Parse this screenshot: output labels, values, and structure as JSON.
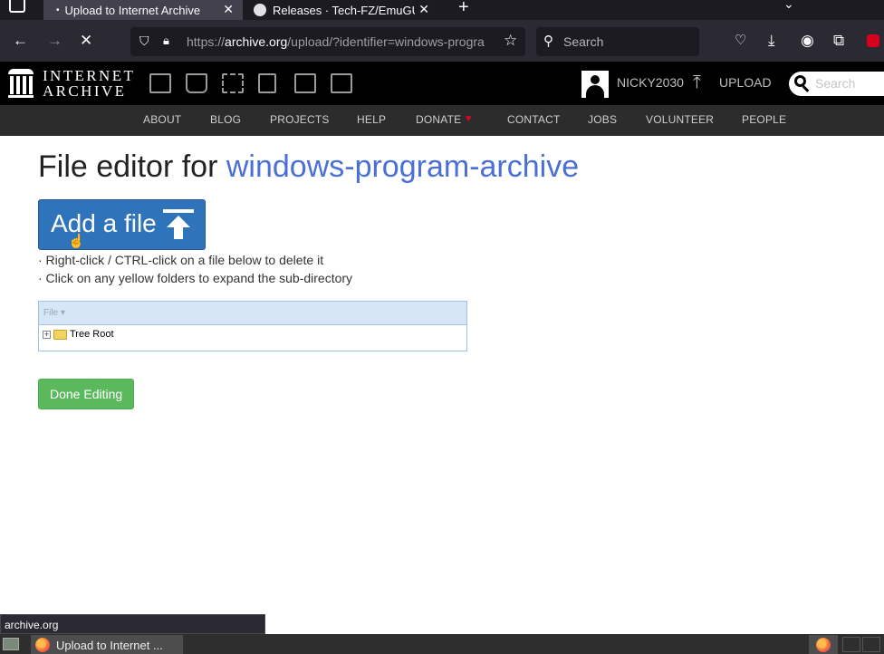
{
  "browser": {
    "tabs": [
      {
        "label": "Upload to Internet Archive",
        "active": true
      },
      {
        "label": "Releases · Tech-FZ/EmuGUI",
        "active": false
      }
    ],
    "url_prefix": "https://",
    "url_host": "archive.org",
    "url_rest": "/upload/?identifier=windows-progra",
    "search_placeholder": "Search"
  },
  "ia_header": {
    "logo_line1": "INTERNET",
    "logo_line2": "ARCHIVE",
    "username": "NICKY2030",
    "upload_label": "UPLOAD",
    "search_placeholder": "Search",
    "nav": [
      "ABOUT",
      "BLOG",
      "PROJECTS",
      "HELP",
      "DONATE",
      "CONTACT",
      "JOBS",
      "VOLUNTEER",
      "PEOPLE"
    ]
  },
  "main": {
    "title_prefix": "File editor for ",
    "identifier": "windows-program-archive",
    "add_file_label": "Add a file",
    "hints": [
      "· Right-click / CTRL-click on a file below to delete it",
      "· Click on any yellow folders to expand the sub-directory"
    ],
    "tree_header": "File ▾",
    "tree_root": "Tree Root",
    "done_label": "Done Editing"
  },
  "status_text": "archive.org",
  "taskbar": {
    "item_label": "Upload to Internet ..."
  }
}
